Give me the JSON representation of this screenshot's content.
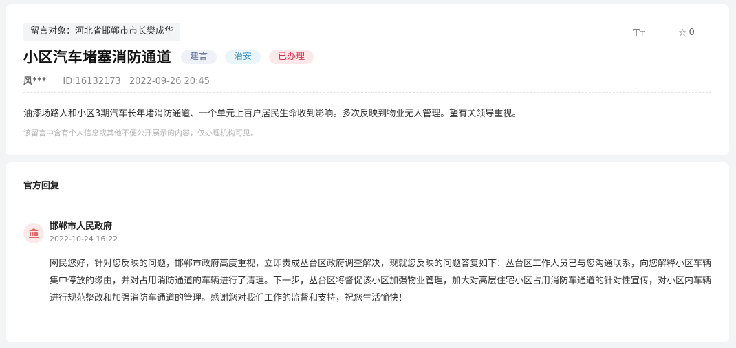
{
  "message": {
    "target_label": "留言对象：河北省邯郸市市长樊成华",
    "title": "小区汽车堵塞消防通道",
    "tags": {
      "type": "建言",
      "category": "治安",
      "status": "已办理"
    },
    "font_toggle": {
      "big": "T",
      "small": "T"
    },
    "favorites_count": "0",
    "author": "风***",
    "id_text": "ID:16132173",
    "time": "2022-09-26 20:45",
    "content": "油漆场路人和小区3期汽车长年堵消防通道、一个单元上百户居民生命收到影响。多次反映到物业无人管理。望有关领导重视。",
    "privacy_note": "该留言中含有个人信息或其他不便公开展示的内容，仅办理机构可见。"
  },
  "reply": {
    "heading": "官方回复",
    "org_name": "邯郸市人民政府",
    "time": "2022-10-24 16:22",
    "content": "网民您好，针对您反映的问题，邯郸市政府高度重视，立即责成丛台区政府调查解决，现就您反映的问题答复如下：丛台区工作人员已与您沟通联系，向您解释小区车辆集中停放的缘由，并对占用消防通道的车辆进行了清理。下一步，丛台区将督促该小区加强物业管理，加大对高层住宅小区占用消防车通道的针对性宣传，对小区内车辆进行规范整改和加强消防车通道的管理。感谢您对我们工作的监督和支持，祝您生活愉快！"
  },
  "colors": {
    "status_red": "#d8324a",
    "category_blue": "#3a93c7",
    "avatar_red": "#e06a6a"
  },
  "icons": {
    "font_size": "font-size-icon",
    "favorite": "star-icon",
    "org_avatar": "government-building-icon"
  }
}
